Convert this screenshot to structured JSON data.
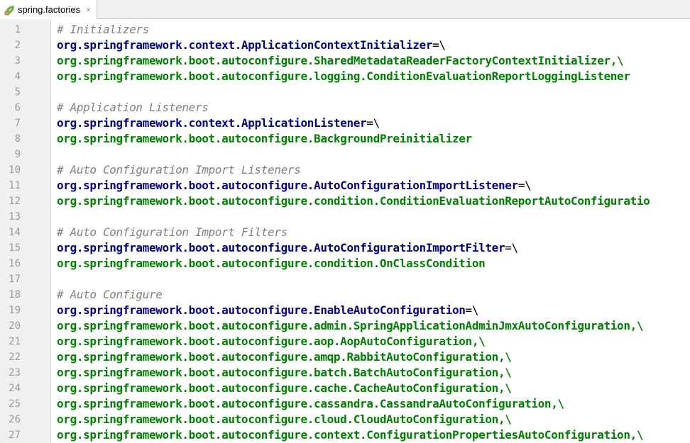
{
  "tab": {
    "label": "spring.factories",
    "icon": "properties-file-icon",
    "close_glyph": "×"
  },
  "colors": {
    "comment": "#808080",
    "key": "#000080",
    "value": "#008000",
    "gutter_bg": "#f0f0f0",
    "line_number": "#999999"
  },
  "lines": [
    {
      "n": "1",
      "type": "comment",
      "text": "# Initializers"
    },
    {
      "n": "2",
      "type": "key",
      "text": "org.springframework.context.ApplicationContextInitializer",
      "sep": "=\\"
    },
    {
      "n": "3",
      "type": "value",
      "text": "org.springframework.boot.autoconfigure.SharedMetadataReaderFactoryContextInitializer,\\"
    },
    {
      "n": "4",
      "type": "value",
      "text": "org.springframework.boot.autoconfigure.logging.ConditionEvaluationReportLoggingListener"
    },
    {
      "n": "5",
      "type": "blank",
      "text": ""
    },
    {
      "n": "6",
      "type": "comment",
      "text": "# Application Listeners"
    },
    {
      "n": "7",
      "type": "key",
      "text": "org.springframework.context.ApplicationListener",
      "sep": "=\\"
    },
    {
      "n": "8",
      "type": "value",
      "text": "org.springframework.boot.autoconfigure.BackgroundPreinitializer"
    },
    {
      "n": "9",
      "type": "blank",
      "text": ""
    },
    {
      "n": "10",
      "type": "comment",
      "text": "# Auto Configuration Import Listeners"
    },
    {
      "n": "11",
      "type": "key",
      "text": "org.springframework.boot.autoconfigure.AutoConfigurationImportListener",
      "sep": "=\\"
    },
    {
      "n": "12",
      "type": "value",
      "text": "org.springframework.boot.autoconfigure.condition.ConditionEvaluationReportAutoConfiguratio"
    },
    {
      "n": "13",
      "type": "blank",
      "text": ""
    },
    {
      "n": "14",
      "type": "comment",
      "text": "# Auto Configuration Import Filters"
    },
    {
      "n": "15",
      "type": "key",
      "text": "org.springframework.boot.autoconfigure.AutoConfigurationImportFilter",
      "sep": "=\\"
    },
    {
      "n": "16",
      "type": "value",
      "text": "org.springframework.boot.autoconfigure.condition.OnClassCondition"
    },
    {
      "n": "17",
      "type": "blank",
      "text": ""
    },
    {
      "n": "18",
      "type": "comment",
      "text": "# Auto Configure"
    },
    {
      "n": "19",
      "type": "key",
      "text": "org.springframework.boot.autoconfigure.EnableAutoConfiguration",
      "sep": "=\\"
    },
    {
      "n": "20",
      "type": "value",
      "text": "org.springframework.boot.autoconfigure.admin.SpringApplicationAdminJmxAutoConfiguration,\\"
    },
    {
      "n": "21",
      "type": "value",
      "text": "org.springframework.boot.autoconfigure.aop.AopAutoConfiguration,\\"
    },
    {
      "n": "22",
      "type": "value",
      "text": "org.springframework.boot.autoconfigure.amqp.RabbitAutoConfiguration,\\"
    },
    {
      "n": "23",
      "type": "value",
      "text": "org.springframework.boot.autoconfigure.batch.BatchAutoConfiguration,\\"
    },
    {
      "n": "24",
      "type": "value",
      "text": "org.springframework.boot.autoconfigure.cache.CacheAutoConfiguration,\\"
    },
    {
      "n": "25",
      "type": "value",
      "text": "org.springframework.boot.autoconfigure.cassandra.CassandraAutoConfiguration,\\"
    },
    {
      "n": "26",
      "type": "value",
      "text": "org.springframework.boot.autoconfigure.cloud.CloudAutoConfiguration,\\"
    },
    {
      "n": "27",
      "type": "value",
      "text": "org.springframework.boot.autoconfigure.context.ConfigurationPropertiesAutoConfiguration,\\"
    }
  ]
}
